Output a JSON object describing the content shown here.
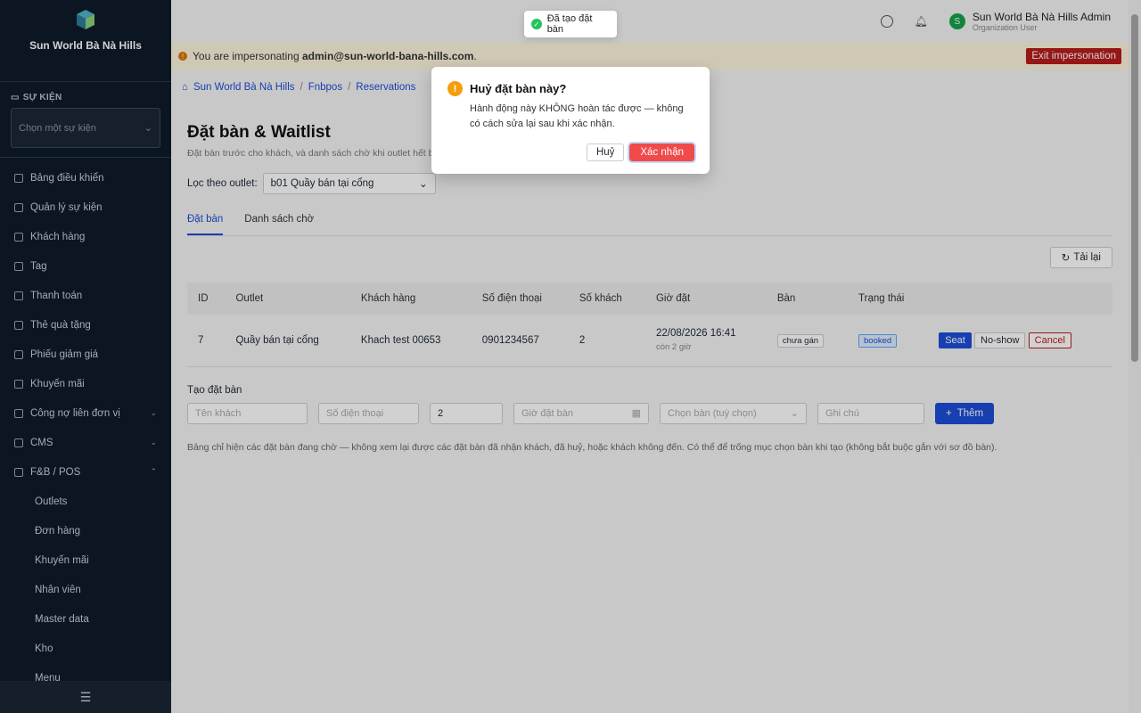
{
  "sidebar": {
    "brand_name": "Sun World Bà Nà Hills",
    "brand_sub": "",
    "event_section_label": "SỰ KIỆN",
    "event_select_placeholder": "Chọn một sự kiện",
    "menu": [
      {
        "label": "Bảng điều khiển",
        "icon": "dashboard-icon"
      },
      {
        "label": "Quản lý sự kiện",
        "icon": "calendar-icon"
      },
      {
        "label": "Khách hàng",
        "icon": "users-icon"
      },
      {
        "label": "Tag",
        "icon": "tag-icon"
      },
      {
        "label": "Thanh toán",
        "icon": "payment-icon"
      },
      {
        "label": "Thẻ quà tặng",
        "icon": "gift-icon"
      },
      {
        "label": "Phiếu giảm giá",
        "icon": "coupon-icon"
      },
      {
        "label": "Khuyến mãi",
        "icon": "promo-icon"
      },
      {
        "label": "Công nợ liên đơn vị",
        "icon": "debt-icon"
      },
      {
        "label": "CMS",
        "icon": "cms-icon"
      },
      {
        "label": "F&B / POS",
        "icon": "fnb-icon"
      }
    ],
    "fnb_sub": [
      "Outlets",
      "Đơn hàng",
      "Khuyến mãi",
      "Nhân viên",
      "Master data",
      "Kho",
      "Menu"
    ]
  },
  "topbar": {
    "user_initial": "S",
    "user_name": "Sun World Bà Nà Hills Admin",
    "user_role": "Organization User"
  },
  "impersonation": {
    "prefix": "You are impersonating",
    "email": "admin@sun-world-bana-hills.com",
    "suffix": ".",
    "exit_label": "Exit impersonation"
  },
  "breadcrumb": [
    "Sun World Bà Nà Hills",
    "Fnbpos",
    "Reservations"
  ],
  "page": {
    "title": "Đặt bàn & Waitlist",
    "desc": "Đặt bàn trước cho khách, và danh sách chờ khi outlet hết b",
    "filter_label": "Lọc theo outlet:",
    "filter_value": "b01 Quầy bán tại cổng",
    "tabs": [
      "Đặt bàn",
      "Danh sách chờ"
    ],
    "reload_label": "Tải lại"
  },
  "table": {
    "headers": [
      "ID",
      "Outlet",
      "Khách hàng",
      "Số điện thoại",
      "Số khách",
      "Giờ đặt",
      "Bàn",
      "Trạng thái",
      ""
    ],
    "rows": [
      {
        "id": "7",
        "outlet": "Quầy bán tại cổng",
        "customer": "Khach test 00653",
        "phone": "0901234567",
        "guests": "2",
        "time": "22/08/2026 16:41",
        "time_sub": "còn 2 giờ",
        "table": "chưa gán",
        "status": "booked",
        "actions": [
          "Seat",
          "No-show",
          "Cancel"
        ]
      }
    ]
  },
  "create": {
    "title": "Tạo đặt bàn",
    "name_placeholder": "Tên khách",
    "phone_placeholder": "Số điện thoại",
    "guests_value": "2",
    "time_placeholder": "Giờ đặt bàn",
    "table_placeholder": "Chọn bàn (tuỳ chọn)",
    "note_placeholder": "Ghi chú",
    "add_label": "Thêm"
  },
  "note": "Bảng chỉ hiện các đặt bàn đang chờ — không xem lại được các đặt bàn đã nhận khách, đã huỷ, hoặc khách không đến. Có thể để trống mục chọn bàn khi tạo (không bắt buộc gắn với sơ đồ bàn).",
  "toast": {
    "text": "Đã tạo đặt bàn"
  },
  "dialog": {
    "title": "Huỷ đặt bàn này?",
    "body": "Hành động này KHÔNG hoàn tác được — không có cách sửa lại sau khi xác nhận.",
    "cancel_label": "Huỷ",
    "confirm_label": "Xác nhận"
  }
}
